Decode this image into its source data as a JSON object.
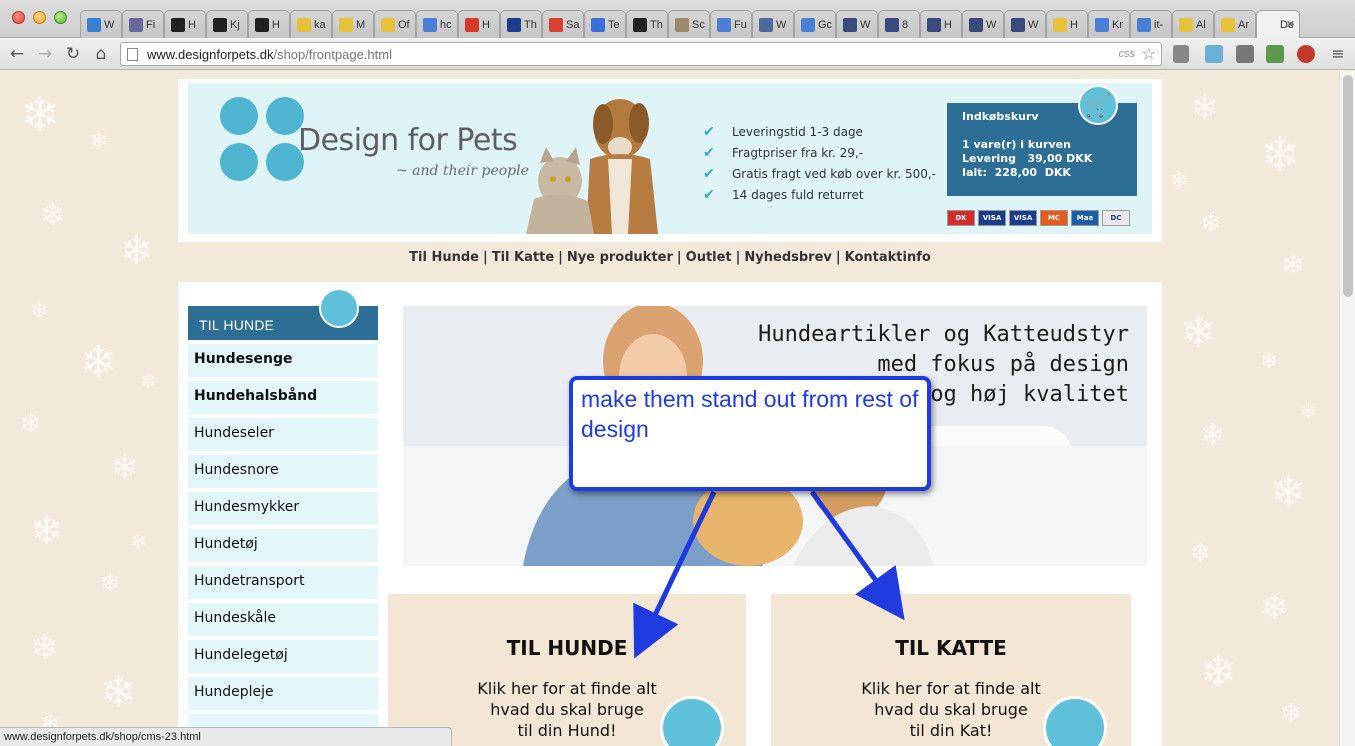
{
  "browser": {
    "tabs": [
      {
        "label": "W",
        "fav": "#3b7fcf"
      },
      {
        "label": "Fi",
        "fav": "#6a6a9c"
      },
      {
        "label": "H",
        "fav": "#222"
      },
      {
        "label": "Kj",
        "fav": "#222"
      },
      {
        "label": "H",
        "fav": "#222"
      },
      {
        "label": "ka",
        "fav": "#e6c23a"
      },
      {
        "label": "M",
        "fav": "#e6c23a"
      },
      {
        "label": "Of",
        "fav": "#e6c23a"
      },
      {
        "label": "hc",
        "fav": "#4a7fd4"
      },
      {
        "label": "H",
        "fav": "#d63a2a"
      },
      {
        "label": "Th",
        "fav": "#1c3d8c"
      },
      {
        "label": "Sa",
        "fav": "#d9412f"
      },
      {
        "label": "Te",
        "fav": "#3a6fd8"
      },
      {
        "label": "Th",
        "fav": "#222"
      },
      {
        "label": "Sc",
        "fav": "#9a8a6a"
      },
      {
        "label": "Fu",
        "fav": "#4a7fd4"
      },
      {
        "label": "W",
        "fav": "#4a6a9c"
      },
      {
        "label": "Gc",
        "fav": "#4a7fd4"
      },
      {
        "label": "W",
        "fav": "#3a4a7c"
      },
      {
        "label": "8",
        "fav": "#3a4a7c"
      },
      {
        "label": "H",
        "fav": "#3a4a7c"
      },
      {
        "label": "W",
        "fav": "#3a4a7c"
      },
      {
        "label": "W",
        "fav": "#3a4a7c"
      },
      {
        "label": "H",
        "fav": "#e6c23a"
      },
      {
        "label": "Kr",
        "fav": "#4a7fd4"
      },
      {
        "label": "it-",
        "fav": "#4a7fd4"
      },
      {
        "label": "Al",
        "fav": "#e6c23a"
      },
      {
        "label": "Ar",
        "fav": "#e6c23a"
      },
      {
        "label": "De",
        "fav": "#f1f1f1",
        "active": true
      }
    ],
    "url_host": "www.designforpets.dk",
    "url_path": "/shop/frontpage.html",
    "css_tag": "css",
    "status_url": "www.designforpets.dk/shop/cms-23.html"
  },
  "header": {
    "logo_title": "Design for Pets",
    "logo_subtitle": "~ and their people",
    "usps": [
      "Leveringstid 1-3 dage",
      "Fragtpriser fra kr. 29,-",
      "Gratis fragt ved køb over kr. 500,-",
      "14 dages fuld returret"
    ],
    "cart": {
      "title": "Indkøbskurv",
      "items_line": "1 vare(r) i kurven",
      "delivery_line": "Levering   39,00 DKK",
      "total_line": "Ialt:  228,00  DKK"
    },
    "payment_cards": [
      {
        "label": "DK",
        "color": "#d62b2b"
      },
      {
        "label": "VISA",
        "color": "#1a3d8f"
      },
      {
        "label": "VISA",
        "color": "#1a3d8f"
      },
      {
        "label": "MC",
        "color": "#e85a1a"
      },
      {
        "label": "Mae",
        "color": "#1a5fa8"
      },
      {
        "label": "DC",
        "color": "#e9e9e9"
      }
    ]
  },
  "topnav": [
    "Til Hunde",
    "Til Katte",
    "Nye produkter",
    "Outlet",
    "Nyhedsbrev",
    "Kontaktinfo"
  ],
  "sidebar": {
    "title": "TIL HUNDE",
    "items": [
      {
        "label": "Hundesenge",
        "bold": true
      },
      {
        "label": "Hundehalsbånd",
        "bold": true
      },
      {
        "label": "Hundeseler"
      },
      {
        "label": "Hundesnore"
      },
      {
        "label": "Hundesmykker"
      },
      {
        "label": "Hundetøj"
      },
      {
        "label": "Hundetransport"
      },
      {
        "label": "Hundeskåle"
      },
      {
        "label": "Hundelegetøj"
      },
      {
        "label": "Hundepleje"
      },
      {
        "label": ""
      }
    ]
  },
  "hero": {
    "lines": [
      "Hundeartikler og Katteudstyr",
      "med fokus på design",
      "og høj kvalitet"
    ]
  },
  "promos": [
    {
      "heading": "TIL HUNDE",
      "lines": [
        "Klik her for at finde alt",
        "hvad du skal bruge",
        "til din Hund!"
      ]
    },
    {
      "heading": "TIL KATTE",
      "lines": [
        "Klik her for at finde alt",
        "hvad du skal bruge",
        "til din Kat!"
      ]
    }
  ],
  "annotation": {
    "text": "make them stand out from rest of design",
    "color": "#1f3be0"
  },
  "colors": {
    "accent_blue": "#2d6e95",
    "light_blue": "#5fc0d9",
    "page_bg": "#f3e9da"
  }
}
